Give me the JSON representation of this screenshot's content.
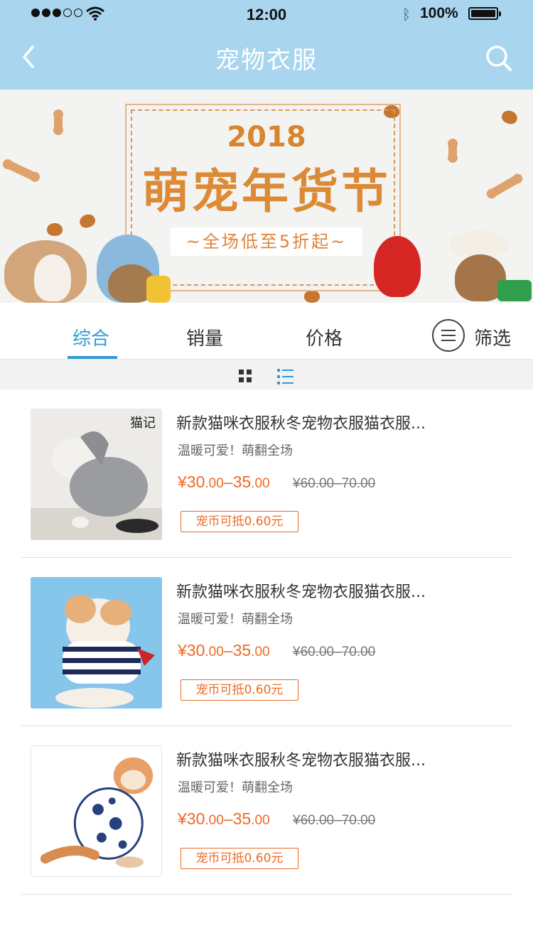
{
  "status_bar": {
    "time": "12:00",
    "battery": "100%"
  },
  "nav": {
    "title": "宠物衣服"
  },
  "banner": {
    "year": "2018",
    "headline": "萌宠年货节",
    "tagline": "~全场低至5折起~"
  },
  "tabs": [
    {
      "label": "综合",
      "active": true
    },
    {
      "label": "销量",
      "active": false
    },
    {
      "label": "价格",
      "active": false
    }
  ],
  "filter": {
    "label": "筛选"
  },
  "view_mode": "list",
  "products": [
    {
      "title": "新款猫咪衣服秋冬宠物衣服猫衣服...",
      "subtitle": "温暖可爱！萌翻全场",
      "price_main": "¥30",
      "price_cents": ".00",
      "price_dash": "–35",
      "price_cents2": ".00",
      "original_price": "¥60.00–70.00",
      "coin_badge": "宠币可抵0.60元",
      "image_label": "猫记",
      "image_bg": "#e9e6e2"
    },
    {
      "title": "新款猫咪衣服秋冬宠物衣服猫衣服...",
      "subtitle": "温暖可爱！萌翻全场",
      "price_main": "¥30",
      "price_cents": ".00",
      "price_dash": "–35",
      "price_cents2": ".00",
      "original_price": "¥60.00–70.00",
      "coin_badge": "宠币可抵0.60元",
      "image_bg": "#86c6ea"
    },
    {
      "title": "新款猫咪衣服秋冬宠物衣服猫衣服...",
      "subtitle": "温暖可爱！萌翻全场",
      "price_main": "¥30",
      "price_cents": ".00",
      "price_dash": "–35",
      "price_cents2": ".00",
      "original_price": "¥60.00–70.00",
      "coin_badge": "宠币可抵0.60元",
      "image_bg": "#ffffff"
    }
  ],
  "colors": {
    "header_bg": "#a9d5ef",
    "accent": "#2f9ad6",
    "price": "#ee6a25",
    "banner_text": "#dc8a35"
  }
}
